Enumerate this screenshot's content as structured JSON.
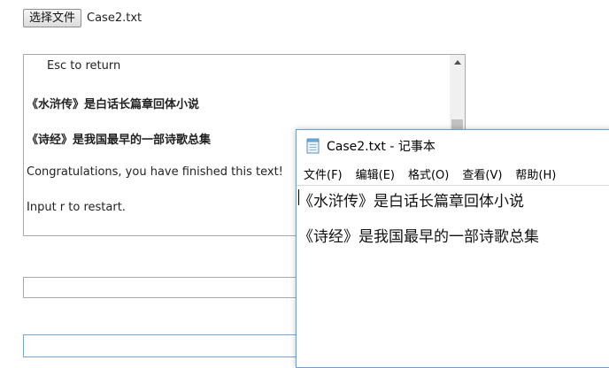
{
  "file_input": {
    "button_label": "选择文件",
    "file_name": "Case2.txt"
  },
  "text_area": {
    "lines": [
      "Esc to return",
      "《水浒传》是白话长篇章回体小说",
      "《诗经》是我国最早的一部诗歌总集",
      "Congratulations, you have finished this text!",
      "Input r to restart."
    ]
  },
  "inputs": {
    "first_value": "",
    "second_value": ""
  },
  "notepad": {
    "title": "Case2.txt - 记事本",
    "menu": [
      "文件(F)",
      "编辑(E)",
      "格式(O)",
      "查看(V)",
      "帮助(H)"
    ],
    "content": [
      "《水浒传》是白话长篇章回体小说",
      "《诗经》是我国最早的一部诗歌总集"
    ]
  }
}
